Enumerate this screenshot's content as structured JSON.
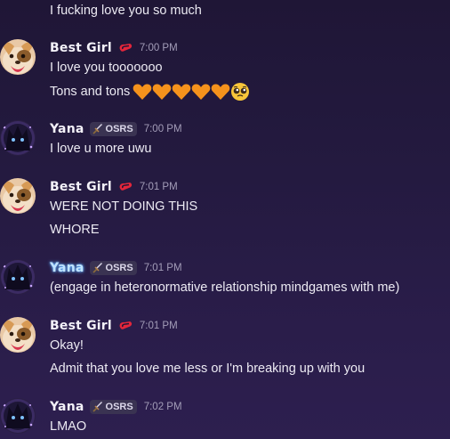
{
  "messages": [
    {
      "type": "continuation",
      "text": "I fucking love you so much"
    },
    {
      "type": "group",
      "author": "Best Girl",
      "role_icon": "pill-icon",
      "time": "7:00 PM",
      "lines": [
        "I love you tooooooo",
        "Tons and tons"
      ],
      "emoji": [
        "orange-heart-icon",
        "orange-heart-icon",
        "orange-heart-icon",
        "orange-heart-icon",
        "orange-heart-icon",
        "pleading-face-icon"
      ]
    },
    {
      "type": "group",
      "author": "Yana",
      "tag": "OSRS",
      "tag_icon": "sword-icon",
      "time": "7:00 PM",
      "lines": [
        "I love u more uwu"
      ]
    },
    {
      "type": "group",
      "author": "Best Girl",
      "role_icon": "pill-icon",
      "time": "7:01 PM",
      "lines": [
        "WERE NOT DOING THIS",
        "WHORE"
      ]
    },
    {
      "type": "group",
      "author": "Yana",
      "tag": "OSRS",
      "tag_icon": "sword-icon",
      "time": "7:01 PM",
      "lines": [
        "(engage in heteronormative relationship mindgames with me)"
      ]
    },
    {
      "type": "group",
      "author": "Best Girl",
      "role_icon": "pill-icon",
      "time": "7:01 PM",
      "lines": [
        "Okay!",
        "Admit that you love me less or I'm breaking up with you"
      ]
    },
    {
      "type": "group",
      "author": "Yana",
      "tag": "OSRS",
      "tag_icon": "sword-icon",
      "time": "7:02 PM",
      "lines": [
        "LMAO"
      ]
    }
  ],
  "colors": {
    "background": "#241a40",
    "text": "#eceaf3",
    "timestamp": "#a39db8",
    "tag_bg": "#3a3352",
    "heart": "#f5921c",
    "role_icon": "#e3263b"
  }
}
